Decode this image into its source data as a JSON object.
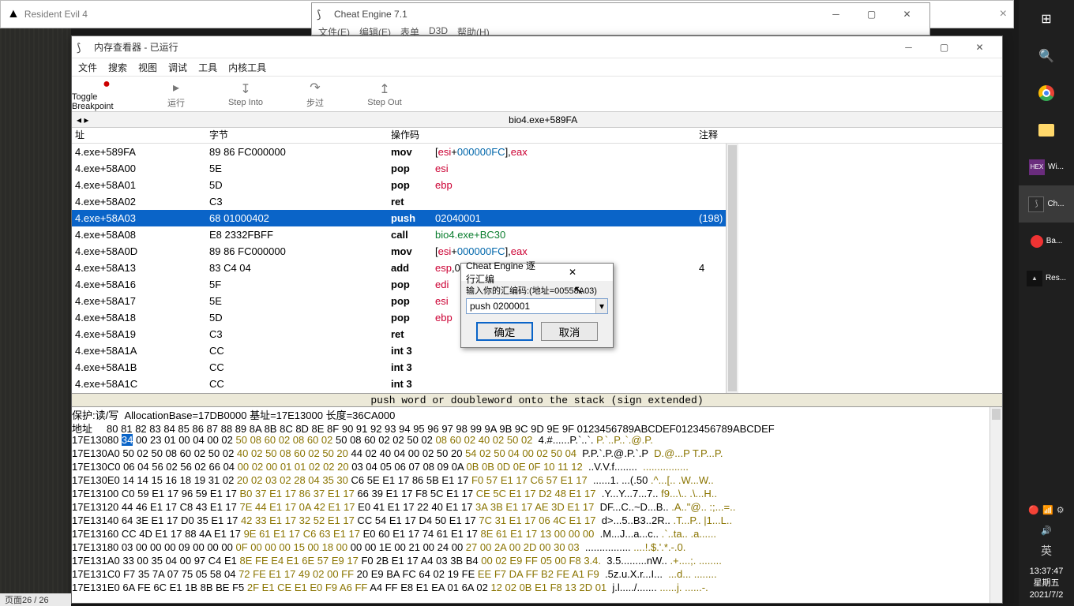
{
  "bg_re4_title": "Resident Evil 4",
  "bg_re4_close": "×",
  "bg_ce": {
    "title": "Cheat Engine 7.1",
    "menu": [
      "文件(E)",
      "编辑(E)",
      "表单",
      "D3D",
      "帮助(H)"
    ]
  },
  "mv": {
    "title": "内存查看器 - 已运行",
    "menu": [
      "文件",
      "搜索",
      "视图",
      "调试",
      "工具",
      "内核工具"
    ],
    "tools": [
      {
        "label": "Toggle Breakpoint",
        "glyph": "●",
        "active": true
      },
      {
        "label": "运行",
        "glyph": "▸"
      },
      {
        "label": "Step Into",
        "glyph": "↧"
      },
      {
        "label": "步过",
        "glyph": "↷"
      },
      {
        "label": "Step Out",
        "glyph": "↥"
      }
    ],
    "addrbar": "bio4.exe+589FA",
    "headers": {
      "addr": "址",
      "bytes": "字节",
      "opcode": "操作码",
      "comment": "注释"
    },
    "rows": [
      {
        "addr": "4.exe+589FA",
        "bytes": "89 86 FC000000",
        "mnem": "mov",
        "args": [
          {
            "t": "txt",
            "v": "["
          },
          {
            "t": "reg",
            "v": "esi"
          },
          {
            "t": "txt",
            "v": "+"
          },
          {
            "t": "num",
            "v": "000000FC"
          },
          {
            "t": "txt",
            "v": "],"
          },
          {
            "t": "reg",
            "v": "eax"
          }
        ],
        "comment": ""
      },
      {
        "addr": "4.exe+58A00",
        "bytes": "5E",
        "mnem": "pop",
        "args": [
          {
            "t": "reg",
            "v": "esi"
          }
        ]
      },
      {
        "addr": "4.exe+58A01",
        "bytes": "5D",
        "mnem": "pop",
        "args": [
          {
            "t": "reg",
            "v": "ebp"
          }
        ]
      },
      {
        "addr": "4.exe+58A02",
        "bytes": "C3",
        "mnem": "ret",
        "args": []
      },
      {
        "addr": "4.exe+58A03",
        "bytes": "68 01000402",
        "mnem": "push",
        "args": [
          {
            "t": "num",
            "v": "02040001"
          }
        ],
        "comment": "(198)",
        "sel": true
      },
      {
        "addr": "4.exe+58A08",
        "bytes": "E8 2332FBFF",
        "mnem": "call",
        "args": [
          {
            "t": "call",
            "v": "bio4.exe+BC30"
          }
        ]
      },
      {
        "addr": "4.exe+58A0D",
        "bytes": "89 86 FC000000",
        "mnem": "mov",
        "args": [
          {
            "t": "txt",
            "v": "["
          },
          {
            "t": "reg",
            "v": "esi"
          },
          {
            "t": "txt",
            "v": "+"
          },
          {
            "t": "num",
            "v": "000000FC"
          },
          {
            "t": "txt",
            "v": "],"
          },
          {
            "t": "reg",
            "v": "eax"
          }
        ]
      },
      {
        "addr": "4.exe+58A13",
        "bytes": "83 C4 04",
        "mnem": "add",
        "args": [
          {
            "t": "reg",
            "v": "esp"
          },
          {
            "t": "txt",
            "v": ",0"
          }
        ],
        "comment": "4"
      },
      {
        "addr": "4.exe+58A16",
        "bytes": "5F",
        "mnem": "pop",
        "args": [
          {
            "t": "reg",
            "v": "edi"
          }
        ]
      },
      {
        "addr": "4.exe+58A17",
        "bytes": "5E",
        "mnem": "pop",
        "args": [
          {
            "t": "reg",
            "v": "esi"
          }
        ]
      },
      {
        "addr": "4.exe+58A18",
        "bytes": "5D",
        "mnem": "pop",
        "args": [
          {
            "t": "reg",
            "v": "ebp"
          }
        ]
      },
      {
        "addr": "4.exe+58A19",
        "bytes": "C3",
        "mnem": "ret",
        "args": []
      },
      {
        "addr": "4.exe+58A1A",
        "bytes": "CC",
        "mnem": "int 3",
        "args": []
      },
      {
        "addr": "4.exe+58A1B",
        "bytes": "CC",
        "mnem": "int 3",
        "args": []
      },
      {
        "addr": "4.exe+58A1C",
        "bytes": "CC",
        "mnem": "int 3",
        "args": []
      },
      {
        "addr": "4.exe+58A1D",
        "bytes": "CC",
        "mnem": "int 3",
        "args": []
      }
    ],
    "status": "push word or doubleword onto the stack (sign extended)"
  },
  "hex": {
    "info": "保护:读/写  AllocationBase=17DB0000 基址=17E13000 长度=36CA000",
    "header": "地址     80 81 82 83 84 85 86 87 88 89 8A 8B 8C 8D 8E 8F 90 91 92 93 94 95 96 97 98 99 9A 9B 9C 9D 9E 9F 0123456789ABCDEF0123456789ABCDEF",
    "rows": [
      {
        "addr": "17E13080",
        "left": "",
        "selByte": "34",
        "hexA": " 00 23 01 00 04 00 02",
        "hexB": "50 08 60 02 08 60 02",
        "hexC": "50 08 60 02 02 50 02",
        "hexD": "08 60 02 40 02 50 02",
        "asciiA": "4.#......P.`..`.",
        "asciiB": "P.`..P..`.@.P."
      },
      {
        "addr": "17E130A0",
        "hexA": "50 02 50 08 60 02 50 02",
        "hexB": "40 02 50 08 60 02 50 20",
        "hexC": "44 02 40 04 00 02 50 20",
        "hexD": "54 02 50 04 00 02 50 04",
        "asciiA": "P.P.`.P.@.P.`.P ",
        "asciiB": "D.@...P T.P...P."
      },
      {
        "addr": "17E130C0",
        "hexA": "06 04 56 02 56 02 66 04",
        "hexB": "00 02 00 01 01 02 02 20",
        "hexC": "03 04 05 06 07 08 09 0A",
        "hexD": "0B 0B 0D 0E 0F 10 11 12",
        "asciiA": "..V.V.f........ ",
        "asciiB": "................"
      },
      {
        "addr": "17E130E0",
        "hexA": "14 14 15 16 18 19 31 02",
        "hexB": "20 02 03 02 28 04 35 30",
        "hexC": "C6 5E E1 17 86 5B E1 17",
        "hexD": "F0 57 E1 17 C6 57 E1 17",
        "asciiA": "......1. ...(.50",
        "asciiB": ".^...[.. .W...W.."
      },
      {
        "addr": "17E13100",
        "hexA": "C0 59 E1 17 96 59 E1 17",
        "hexB": "B0 37 E1 17 86 37 E1 17",
        "hexC": "66 39 E1 17 F8 5C E1 17",
        "hexD": "CE 5C E1 17 D2 48 E1 17",
        "asciiA": ".Y...Y...7...7..",
        "asciiB": "f9...\\.. .\\...H.."
      },
      {
        "addr": "17E13120",
        "hexA": "44 46 E1 17 C8 43 E1 17",
        "hexB": "7E 44 E1 17 0A 42 E1 17",
        "hexC": "E0 41 E1 17 22 40 E1 17",
        "hexD": "3A 3B E1 17 AE 3D E1 17",
        "asciiA": "DF...C..~D...B..",
        "asciiB": ".A..\"@.. :;...=.."
      },
      {
        "addr": "17E13140",
        "hexA": "64 3E E1 17 D0 35 E1 17",
        "hexB": "42 33 E1 17 32 52 E1 17",
        "hexC": "CC 54 E1 17 D4 50 E1 17",
        "hexD": "7C 31 E1 17 06 4C E1 17",
        "asciiA": "d>...5..B3..2R..",
        "asciiB": ".T...P.. |1...L.."
      },
      {
        "addr": "17E13160",
        "hexA": "CC 4D E1 17 88 4A E1 17",
        "hexB": "9E 61 E1 17 C6 63 E1 17",
        "hexC": "E0 60 E1 17 74 61 E1 17",
        "hexD": "8E 61 E1 17 13 00 00 00",
        "asciiA": ".M...J...a...c..",
        "asciiB": ".`..ta.. .a......"
      },
      {
        "addr": "17E13180",
        "hexA": "03 00 00 00 09 00 00 00",
        "hexB": "0F 00 00 00 15 00 18 00",
        "hexC": "00 00 1E 00 21 00 24 00",
        "hexD": "27 00 2A 00 2D 00 30 03",
        "asciiA": "................",
        "asciiB": "....!.$.'.*.-.0."
      },
      {
        "addr": "17E131A0",
        "hexA": "33 00 35 04 00 97 C4 E1",
        "hexB": "8E FE E4 E1 6E 57 E9 17",
        "hexC": "F0 2B E1 17 A4 03 3B B4",
        "hexD": "00 02 E9 FF 05 00 F8 3.4.",
        "asciiA": "3.5.........nW..",
        "asciiB": ".+....;. ........"
      },
      {
        "addr": "17E131C0",
        "hexA": "F7 35 7A 07 75 05 58 04",
        "hexB": "72 FE E1 17 49 02 00 FF",
        "hexC": "20 E9 BA FC 64 02 19 FE",
        "hexD": "EE F7 DA FF B2 FE A1 F9",
        "asciiA": ".5z.u.X.r...I...",
        "asciiB": " ...d... ........"
      },
      {
        "addr": "17E131E0",
        "hexA": "6A FE 6C E1 1B 8B BE F5",
        "hexB": "2F E1 CE E1 E0 F9 A6 FF",
        "hexC": "A4 FF E8 E1 EA 01 6A 02",
        "hexD": "12 02 0B E1 F8 13 2D 01",
        "asciiA": "j.l...../.......",
        "asciiB": "......j. ......-."
      }
    ]
  },
  "dlg": {
    "title": "Cheat Engine 逐行汇编",
    "label": "输入你的汇编码:(地址=00558A03)",
    "value": "push 0200001",
    "ok": "确定",
    "cancel": "取消"
  },
  "taskbar": {
    "items": [
      {
        "name": "start",
        "glyph": "⊞"
      },
      {
        "name": "search",
        "glyph": "🔍"
      },
      {
        "name": "chrome"
      },
      {
        "name": "explorer"
      },
      {
        "name": "hex",
        "label": "Wi..."
      },
      {
        "name": "cheatengine",
        "label": "Ch...",
        "active": true
      },
      {
        "name": "record",
        "label": "Ba..."
      },
      {
        "name": "re4",
        "label": "Res..."
      }
    ],
    "tray": {
      "icons": [
        "🔴",
        "📶",
        "⚙"
      ],
      "vol": "🔊",
      "ime": "英"
    },
    "clock": {
      "time": "13:37:47",
      "day": "星期五",
      "date": "2021/7/2"
    }
  },
  "footer": "页面26 / 26"
}
